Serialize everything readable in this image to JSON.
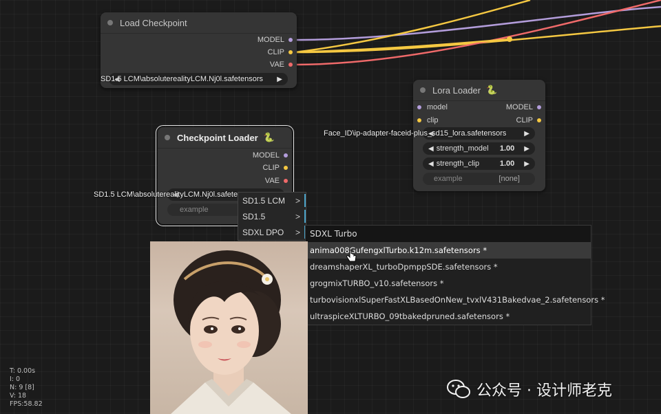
{
  "colors": {
    "model": "#b39ddb",
    "clip": "#f5c842",
    "vae": "#f06a6a",
    "accent_bar": "#4aa3c8"
  },
  "load_checkpoint": {
    "title": "Load Checkpoint",
    "outputs": [
      "MODEL",
      "CLIP",
      "VAE"
    ],
    "ckpt_text": "SD1.5 LCM\\absoluterealityLCM.Nj0l.safetensors"
  },
  "lora_loader": {
    "title": "Lora Loader",
    "inputs": [
      "model",
      "clip"
    ],
    "outputs": [
      "MODEL",
      "CLIP"
    ],
    "lora_text": "Face_ID\\ip-adapter-faceid-plus_sd15_lora.safetensors",
    "strength_model_label": "strength_model",
    "strength_model_value": "1.00",
    "strength_clip_label": "strength_clip",
    "strength_clip_value": "1.00",
    "example_label": "example",
    "example_value": "[none]"
  },
  "checkpoint_loader": {
    "title": "Checkpoint Loader",
    "outputs": [
      "MODEL",
      "CLIP",
      "VAE"
    ],
    "ckpt_text": "SD1.5 LCM\\absoluterealityLCM.Nj0l.safetensors",
    "example_label": "example"
  },
  "menu": {
    "items": [
      "SD1.5 LCM",
      "SD1.5",
      "SDXL DPO"
    ],
    "chevron": ">"
  },
  "submenu": {
    "header": "SDXL Turbo",
    "items": [
      "anima008GufengxlTurbo.k12m.safetensors *",
      "dreamshaperXL_turboDpmppSDE.safetensors *",
      "grogmixTURBO_v10.safetensors *",
      "turbovisionxlSuperFastXLBasedOnNew_tvxlV431Bakedvae_2.safetensors *",
      "ultraspiceXLTURBO_09tbakedpruned.safetensors *"
    ],
    "highlighted_index": 0
  },
  "stats": {
    "t": "T: 0.00s",
    "i": "I: 0",
    "n": "N: 9 [8]",
    "v": "V: 18",
    "fps": "FPS:58.82"
  },
  "watermark": {
    "text": "公众号 · 设计师老克",
    "icon": "wechat-icon"
  }
}
